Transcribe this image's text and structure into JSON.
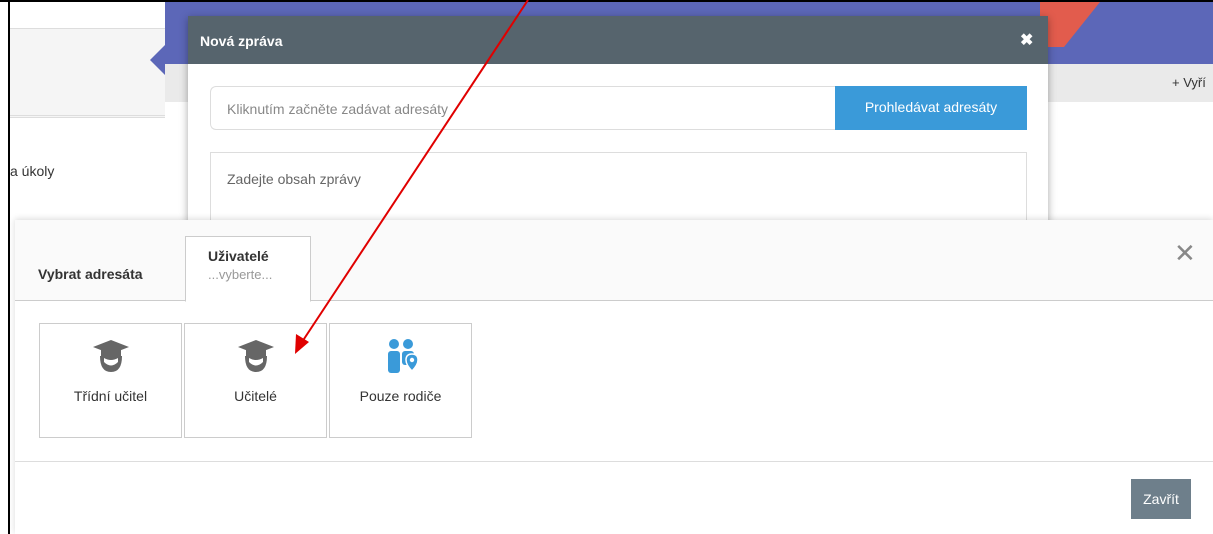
{
  "background": {
    "add_link": "+ Vyří",
    "tasks_label": "a úkoly"
  },
  "message_dialog": {
    "title": "Nová zpráva",
    "recipient_placeholder": "Kliknutím začněte zadávat adresáty",
    "search_recipients_button": "Prohledávat adresáty",
    "body_placeholder": "Zadejte obsah zprávy"
  },
  "recipient_picker": {
    "tab_select_label": "Vybrat adresáta",
    "tab_users": {
      "title": "Uživatelé",
      "subtitle": "...vyberte..."
    },
    "tiles": [
      {
        "label": "Třídní učitel",
        "icon": "graduate-icon"
      },
      {
        "label": "Učitelé",
        "icon": "graduate-icon"
      },
      {
        "label": "Pouze rodiče",
        "icon": "parents-icon"
      }
    ],
    "close_button": "Zavřít"
  },
  "colors": {
    "header_blue": "#5c67b8",
    "dialog_header": "#56646d",
    "primary_button": "#3a9ad9",
    "close_button": "#6e7f8b",
    "annotation_arrow": "#e00000"
  }
}
